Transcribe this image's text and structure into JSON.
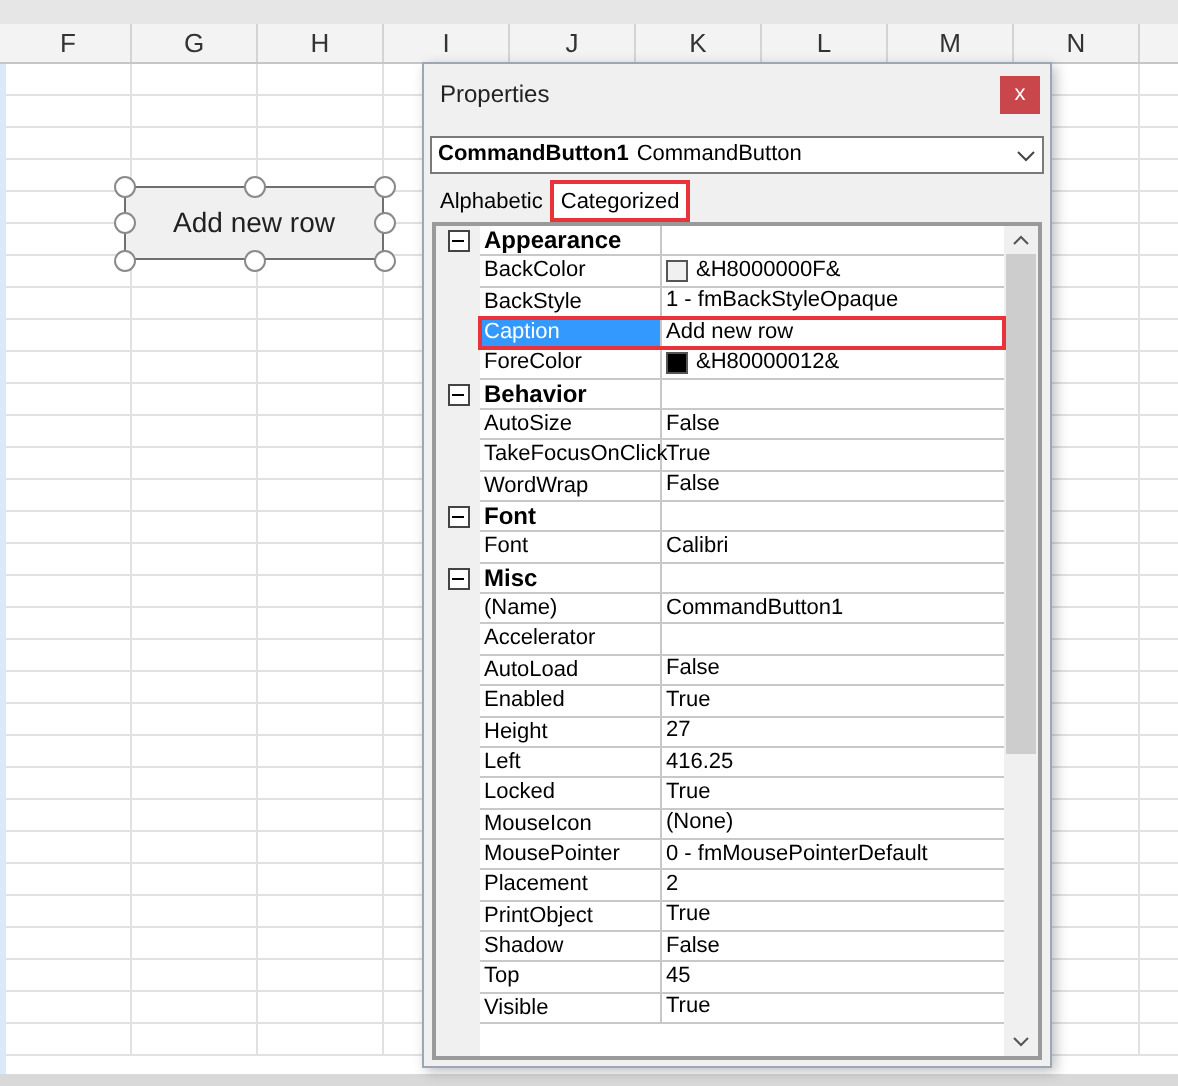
{
  "sheet": {
    "columns": [
      "F",
      "G",
      "H",
      "I",
      "J",
      "K",
      "L",
      "M",
      "N"
    ],
    "command_button": {
      "label": "Add new row",
      "selected": true
    }
  },
  "properties": {
    "title": "Properties",
    "close": "x",
    "object_selector": {
      "name": "CommandButton1",
      "type": "CommandButton"
    },
    "tabs": [
      {
        "label": "Alphabetic",
        "selected": false,
        "highlighted": false
      },
      {
        "label": "Categorized",
        "selected": true,
        "highlighted": true
      }
    ],
    "categories": [
      {
        "name": "Appearance",
        "expanded": true,
        "items": [
          {
            "name": "BackColor",
            "value": "&H8000000F&",
            "color": "#f0f0f0",
            "selected": false,
            "highlighted": false
          },
          {
            "name": "BackStyle",
            "value": "1 - fmBackStyleOpaque",
            "selected": false,
            "highlighted": false
          },
          {
            "name": "Caption",
            "value": "Add new row",
            "selected": true,
            "highlighted": true
          },
          {
            "name": "ForeColor",
            "value": "&H80000012&",
            "color": "#000000",
            "selected": false,
            "highlighted": false
          }
        ]
      },
      {
        "name": "Behavior",
        "expanded": true,
        "items": [
          {
            "name": "AutoSize",
            "value": "False",
            "selected": false,
            "highlighted": false
          },
          {
            "name": "TakeFocusOnClick",
            "value": "True",
            "selected": false,
            "highlighted": false
          },
          {
            "name": "WordWrap",
            "value": "False",
            "selected": false,
            "highlighted": false
          }
        ]
      },
      {
        "name": "Font",
        "expanded": true,
        "items": [
          {
            "name": "Font",
            "value": "Calibri",
            "selected": false,
            "highlighted": false
          }
        ]
      },
      {
        "name": "Misc",
        "expanded": true,
        "items": [
          {
            "name": "(Name)",
            "value": "CommandButton1",
            "selected": false,
            "highlighted": false
          },
          {
            "name": "Accelerator",
            "selected": false,
            "highlighted": false
          },
          {
            "name": "AutoLoad",
            "value": "False",
            "selected": false,
            "highlighted": false
          },
          {
            "name": "Enabled",
            "value": "True",
            "selected": false,
            "highlighted": false
          },
          {
            "name": "Height",
            "value": "27",
            "selected": false,
            "highlighted": false
          },
          {
            "name": "Left",
            "value": "416.25",
            "selected": false,
            "highlighted": false
          },
          {
            "name": "Locked",
            "value": "True",
            "selected": false,
            "highlighted": false
          },
          {
            "name": "MouseIcon",
            "value": "(None)",
            "selected": false,
            "highlighted": false
          },
          {
            "name": "MousePointer",
            "value": "0 - fmMousePointerDefault",
            "selected": false,
            "highlighted": false
          },
          {
            "name": "Placement",
            "value": "2",
            "selected": false,
            "highlighted": false
          },
          {
            "name": "PrintObject",
            "value": "True",
            "selected": false,
            "highlighted": false
          },
          {
            "name": "Shadow",
            "value": "False",
            "selected": false,
            "highlighted": false
          },
          {
            "name": "Top",
            "value": "45",
            "selected": false,
            "highlighted": false
          },
          {
            "name": "Visible",
            "value": "True",
            "selected": false,
            "highlighted": false
          }
        ]
      }
    ]
  }
}
